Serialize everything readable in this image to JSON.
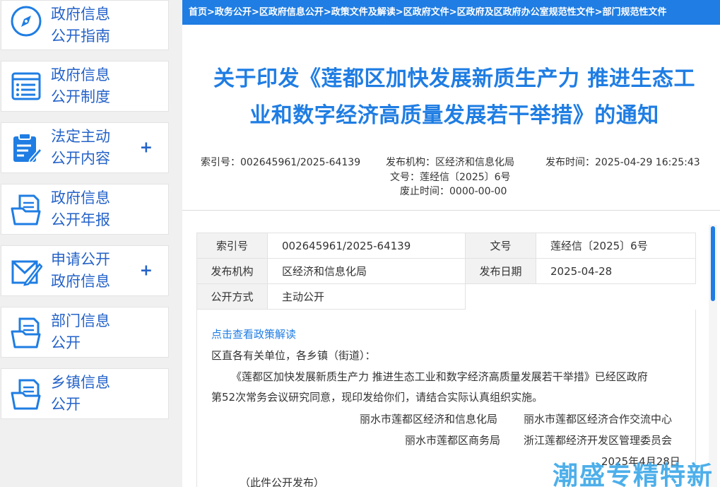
{
  "sidebar": {
    "items": [
      {
        "line1": "政府信息",
        "line2": "公开指南",
        "icon": "compass-icon",
        "plus": ""
      },
      {
        "line1": "政府信息",
        "line2": "公开制度",
        "icon": "document-list-icon",
        "plus": ""
      },
      {
        "line1": "法定主动",
        "line2": "公开内容",
        "icon": "clipboard-edit-icon",
        "plus": "+"
      },
      {
        "line1": "政府信息",
        "line2": "公开年报",
        "icon": "folder-doc-icon",
        "plus": ""
      },
      {
        "line1": "申请公开",
        "line2": "政府信息",
        "icon": "envelope-pen-icon",
        "plus": "+"
      },
      {
        "line1": "部门信息",
        "line2": "公开",
        "icon": "folder-doc-icon",
        "plus": ""
      },
      {
        "line1": "乡镇信息",
        "line2": "公开",
        "icon": "folder-doc-icon",
        "plus": ""
      }
    ]
  },
  "breadcrumb": [
    "首页",
    "政务公开",
    "区政府信息公开",
    "政策文件及解读",
    "区政府文件",
    "区政府及区政府办公室规范性文件",
    "部门规范性文件"
  ],
  "breadcrumb_sep": ">",
  "title": {
    "line1": "关于印发《莲都区加快发展新质生产力 推进生态工",
    "line2": "业和数字经济高质量发展若干举措》的通知"
  },
  "meta": {
    "index_label": "索引号：",
    "index_value": "002645961/2025-64139",
    "org_label": "发布机构：",
    "org_value": "区经济和信息化局",
    "time_label": "发布时间：",
    "time_value": "2025-04-29 16:25:43",
    "docno_label": "文号：",
    "docno_value": "莲经信〔2025〕6号",
    "expire_label": "废止时间：",
    "expire_value": "0000-00-00"
  },
  "info_table": {
    "index_label": "索引号",
    "index_value": "002645961/2025-64139",
    "docno_label": "文号",
    "docno_value": "莲经信〔2025〕6号",
    "org_label": "发布机构",
    "org_value": "区经济和信息化局",
    "date_label": "发布日期",
    "date_value": "2025-04-28",
    "mode_label": "公开方式",
    "mode_value": "主动公开"
  },
  "body": {
    "read_link": "点击查看政策解读",
    "greeting": "区直各有关单位，各乡镇（街道）：",
    "para1_line1": "《莲都区加快发展新质生产力 推进生态工业和数字经济高质量发展若干举措》已经区政府",
    "para1_line2": "第52次常务会议研究同意，现印发给你们，请结合实际认真组织实施。",
    "sign1a": "丽水市莲都区经济和信息化局",
    "sign1b": "丽水市莲都区经济合作交流中心",
    "sign2a": "丽水市莲都区商务局",
    "sign2b": "浙江莲都经济开发区管理委员会",
    "date": "2025年4月28日",
    "note": "（此件公开发布）"
  },
  "watermark": "潮盛专精特新",
  "colors": {
    "accent": "#1f7de3",
    "text": "#333333",
    "sidebar_bg": "#f0f0f0"
  }
}
